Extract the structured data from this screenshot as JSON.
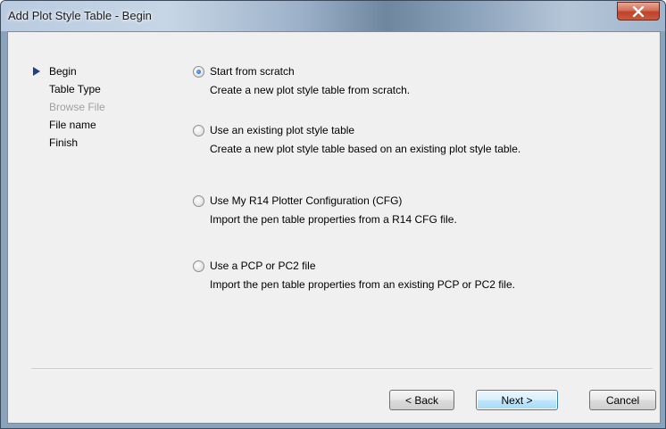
{
  "window": {
    "title": "Add Plot Style Table - Begin"
  },
  "nav": {
    "items": [
      {
        "label": "Begin",
        "state": "current"
      },
      {
        "label": "Table Type",
        "state": "enabled"
      },
      {
        "label": "Browse File",
        "state": "disabled"
      },
      {
        "label": "File name",
        "state": "enabled"
      },
      {
        "label": "Finish",
        "state": "enabled"
      }
    ]
  },
  "options": [
    {
      "label": "Start from scratch",
      "description": "Create a new plot style table from scratch.",
      "checked": true
    },
    {
      "label": "Use an existing plot style table",
      "description": "Create a new plot style table based on an existing plot style table.",
      "checked": false
    },
    {
      "label": "Use My R14 Plotter Configuration (CFG)",
      "description": "Import the pen table properties from a R14 CFG file.",
      "checked": false
    },
    {
      "label": "Use a PCP or PC2 file",
      "description": "Import the pen table properties from an existing PCP or PC2 file.",
      "checked": false
    }
  ],
  "buttons": {
    "back": "< Back",
    "next": "Next >",
    "cancel": "Cancel"
  },
  "colors": {
    "nav_arrow": "#1f3f8c",
    "close_button": "#c0412a",
    "default_button_border": "#3c7fb1"
  },
  "icons": {
    "close": "close-icon",
    "current_step": "triangle-right-icon"
  }
}
